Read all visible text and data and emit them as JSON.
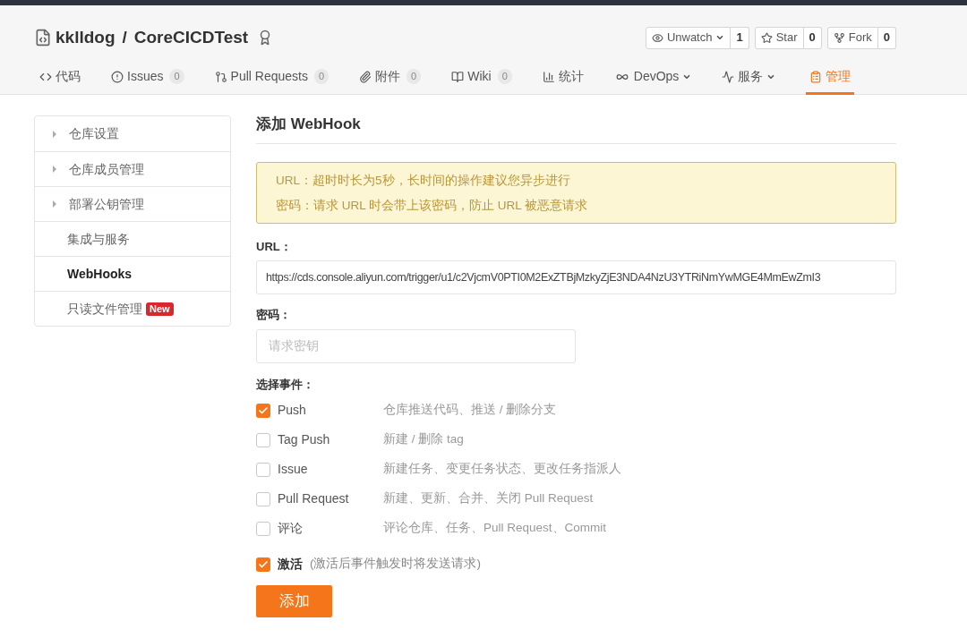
{
  "repo": {
    "owner": "kklldog",
    "separator": "/",
    "name": "CoreCICDTest"
  },
  "repo_actions": [
    {
      "kind": "watch",
      "label": "Unwatch",
      "dropdown": true,
      "count": "1"
    },
    {
      "kind": "star",
      "label": "Star",
      "dropdown": false,
      "count": "0"
    },
    {
      "kind": "fork",
      "label": "Fork",
      "dropdown": false,
      "count": "0"
    }
  ],
  "tabs": [
    {
      "kind": "code",
      "label": "代码",
      "selected": false
    },
    {
      "kind": "issues",
      "label": "Issues",
      "count": "0",
      "selected": false
    },
    {
      "kind": "pull",
      "label": "Pull Requests",
      "count": "0",
      "selected": false
    },
    {
      "kind": "attach",
      "label": "附件",
      "count": "0",
      "selected": false
    },
    {
      "kind": "wiki",
      "label": "Wiki",
      "count": "0",
      "selected": false
    },
    {
      "kind": "stats",
      "label": "统计",
      "selected": false
    },
    {
      "kind": "devops",
      "label": "DevOps",
      "dropdown": true,
      "selected": false
    },
    {
      "kind": "service",
      "label": "服务",
      "dropdown": true,
      "selected": false
    },
    {
      "kind": "manage",
      "label": "管理",
      "selected": true
    }
  ],
  "sidebar": {
    "items": [
      {
        "label": "仓库设置",
        "expandable": true,
        "selected": false
      },
      {
        "label": "仓库成员管理",
        "expandable": true,
        "selected": false
      },
      {
        "label": "部署公钥管理",
        "expandable": true,
        "selected": false
      },
      {
        "label": "集成与服务",
        "expandable": false,
        "selected": false
      },
      {
        "label": "WebHooks",
        "expandable": false,
        "selected": true
      },
      {
        "label": "只读文件管理",
        "expandable": false,
        "badge": "New",
        "selected": false
      }
    ]
  },
  "form": {
    "title": "添加 WebHook",
    "notice": [
      "URL：超时时长为5秒，长时间的操作建议您异步进行",
      "密码：请求 URL 时会带上该密码，防止 URL 被恶意请求"
    ],
    "url": {
      "label": "URL：",
      "value": "https://cds.console.aliyun.com/trigger/u1/c2VjcmV0PTI0M2ExZTBjMzkyZjE3NDA4NzU3YTRiNmYwMGE4MmEwZmI3"
    },
    "password": {
      "label": "密码：",
      "placeholder": "请求密钥"
    },
    "events_label": "选择事件：",
    "events": [
      {
        "label": "Push",
        "description": "仓库推送代码、推送 / 删除分支",
        "checked": true
      },
      {
        "label": "Tag Push",
        "description": "新建 / 删除 tag",
        "checked": false
      },
      {
        "label": "Issue",
        "description": "新建任务、变更任务状态、更改任务指派人",
        "checked": false
      },
      {
        "label": "Pull Request",
        "description": "新建、更新、合并、关闭 Pull Request",
        "checked": false
      },
      {
        "label": "评论",
        "description": "评论仓库、任务、Pull Request、Commit",
        "checked": false
      }
    ],
    "active": {
      "label": "激活",
      "hint": "(激活后事件触发时将发送请求)",
      "checked": true
    },
    "submit": "添加"
  }
}
